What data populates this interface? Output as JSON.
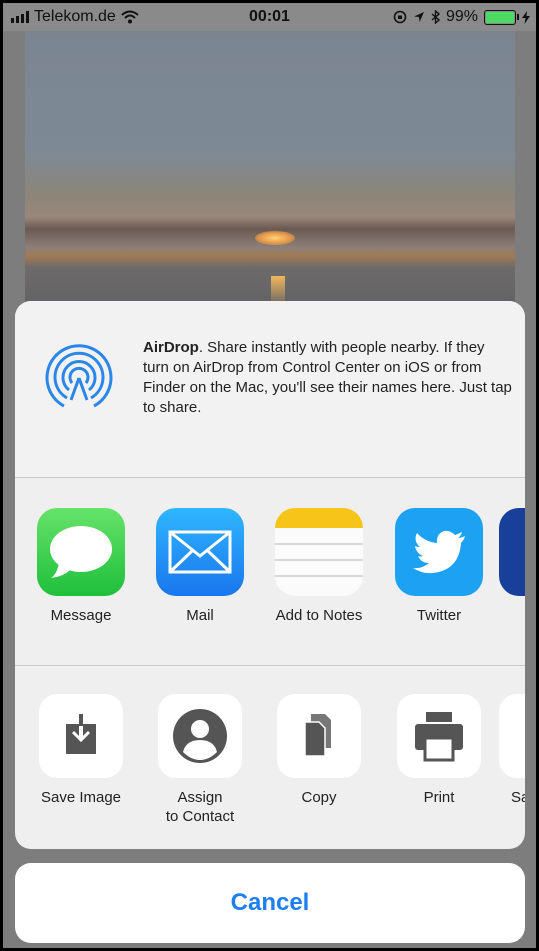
{
  "status_bar": {
    "carrier": "Telekom.de",
    "time": "00:01",
    "battery_percent": "99%",
    "battery_level": 0.99,
    "icons": [
      "signal-icon",
      "wifi-icon",
      "orientation-lock-icon",
      "location-icon",
      "bluetooth-icon",
      "battery-icon",
      "charging-icon"
    ]
  },
  "airdrop": {
    "title": "AirDrop",
    "description": ". Share instantly with people nearby. If they turn on AirDrop from Control Center on iOS or from Finder on the Mac, you'll see their names here. Just tap to share."
  },
  "apps": [
    {
      "label": "Message",
      "icon": "messages-icon"
    },
    {
      "label": "Mail",
      "icon": "mail-icon"
    },
    {
      "label": "Add to Notes",
      "icon": "notes-icon"
    },
    {
      "label": "Twitter",
      "icon": "twitter-icon"
    }
  ],
  "actions": [
    {
      "label": "Save Image",
      "icon": "save-image-icon"
    },
    {
      "label": "Assign\nto Contact",
      "icon": "contact-icon"
    },
    {
      "label": "Copy",
      "icon": "copy-icon"
    },
    {
      "label": "Print",
      "icon": "print-icon"
    },
    {
      "label": "Sa",
      "icon": "partial-action-icon"
    }
  ],
  "cancel_label": "Cancel",
  "colors": {
    "accent": "#1e7ef5",
    "messages_green": "#4cd964",
    "mail_blue": "#1a8cf0",
    "twitter_blue": "#1da1f2",
    "airdrop_blue": "#2a86e8"
  }
}
